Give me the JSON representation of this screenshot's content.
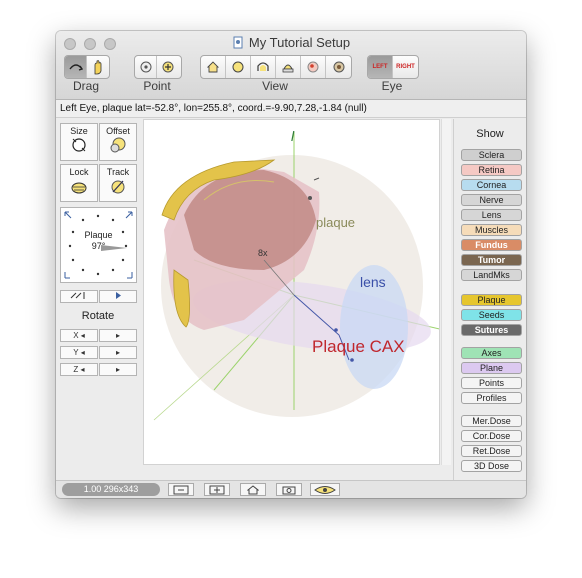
{
  "window": {
    "title": "My Tutorial Setup"
  },
  "toolbar": {
    "groups": [
      {
        "label": "Drag"
      },
      {
        "label": "Point"
      },
      {
        "label": "View"
      },
      {
        "label": "Eye"
      }
    ],
    "eye_left": "LEFT",
    "eye_right": "RIGHT"
  },
  "status": {
    "text": "Left Eye, plaque lat=-52.8°, lon=255.8°, coord.=-9.90,7.28,-1.84  (null)"
  },
  "left_panel": {
    "size_label": "Size",
    "offset_label": "Offset",
    "lock_label": "Lock",
    "track_label": "Track",
    "dial_label": "Plaque",
    "dial_value": "97°",
    "rotate_label": "Rotate",
    "axis_x": "X",
    "axis_y": "Y",
    "axis_z": "Z"
  },
  "viewport": {
    "axis_label": "l",
    "plaque_label": "plaque",
    "lens_label": "lens",
    "cax_label": "Plaque CAX",
    "marker_label": "8x"
  },
  "show_panel": {
    "title": "Show",
    "items": [
      {
        "label": "Sclera",
        "color": "#cfcfcf"
      },
      {
        "label": "Retina",
        "color": "#f5c9c4"
      },
      {
        "label": "Cornea",
        "color": "#b7dcef"
      },
      {
        "label": "Nerve",
        "color": "#d6d6d6"
      },
      {
        "label": "Lens",
        "color": "#d6d6d6"
      },
      {
        "label": "Muscles",
        "color": "#f6dcb9"
      },
      {
        "label": "Fundus",
        "color": "#d98c66"
      },
      {
        "label": "Tumor",
        "color": "#7a6650"
      },
      {
        "label": "LandMks",
        "color": "#d6d6d6"
      },
      {
        "label": "Plaque",
        "color": "#e6c62e"
      },
      {
        "label": "Seeds",
        "color": "#7fe3e8"
      },
      {
        "label": "Sutures",
        "color": "#6a6a6a"
      },
      {
        "label": "Axes",
        "color": "#9fe3b5"
      },
      {
        "label": "Plane",
        "color": "#dcc9f0"
      },
      {
        "label": "Points",
        "color": "#f4f4f4"
      },
      {
        "label": "Profiles",
        "color": "#f4f4f4"
      },
      {
        "label": "Mer.Dose",
        "color": "#f4f4f4"
      },
      {
        "label": "Cor.Dose",
        "color": "#f4f4f4"
      },
      {
        "label": "Ret.Dose",
        "color": "#f4f4f4"
      },
      {
        "label": "3D Dose",
        "color": "#f4f4f4"
      }
    ]
  },
  "bottom": {
    "zoom_text": "1.00 296x343"
  }
}
